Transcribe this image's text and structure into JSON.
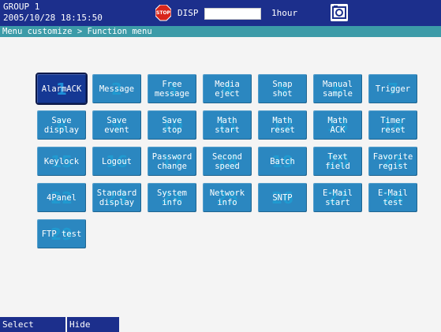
{
  "status": {
    "group": "GROUP 1",
    "datetime": "2005/10/28 18:15:50",
    "stop_icon_text": "STOP",
    "mode": "DISP",
    "time_span": "1hour"
  },
  "breadcrumb": "Menu customize > Function menu",
  "menu_items": [
    {
      "line1": "AlarmACK",
      "line2": "",
      "slot": "1"
    },
    {
      "line1": "Message",
      "line2": "",
      "slot": "2"
    },
    {
      "line1": "Free",
      "line2": "message",
      "slot": "3"
    },
    {
      "line1": "Media",
      "line2": "eject",
      "slot": "4"
    },
    {
      "line1": "Snap",
      "line2": "shot",
      "slot": "5"
    },
    {
      "line1": "Manual",
      "line2": "sample",
      "slot": "6"
    },
    {
      "line1": "Trigger",
      "line2": "",
      "slot": "7"
    },
    {
      "line1": "Save",
      "line2": "display",
      "slot": "8"
    },
    {
      "line1": "Save",
      "line2": "event",
      "slot": "9"
    },
    {
      "line1": "Save",
      "line2": "stop",
      "slot": "10"
    },
    {
      "line1": "Math",
      "line2": "start",
      "slot": "11"
    },
    {
      "line1": "Math",
      "line2": "reset",
      "slot": "12"
    },
    {
      "line1": "Math",
      "line2": "ACK",
      "slot": "13"
    },
    {
      "line1": "Timer",
      "line2": "reset",
      "slot": "14"
    },
    {
      "line1": "Keylock",
      "line2": "",
      "slot": "15"
    },
    {
      "line1": "Logout",
      "line2": "",
      "slot": "16"
    },
    {
      "line1": "Password",
      "line2": "change",
      "slot": "17"
    },
    {
      "line1": "Second",
      "line2": "speed",
      "slot": "18"
    },
    {
      "line1": "Batch",
      "line2": "",
      "slot": "19"
    },
    {
      "line1": "Text",
      "line2": "field",
      "slot": "20"
    },
    {
      "line1": "Favorite",
      "line2": "regist",
      "slot": "21"
    },
    {
      "line1": "4Panel",
      "line2": "",
      "slot": "22"
    },
    {
      "line1": "Standard",
      "line2": "display",
      "slot": "23"
    },
    {
      "line1": "System",
      "line2": "info",
      "slot": "24"
    },
    {
      "line1": "Network",
      "line2": "info",
      "slot": "25"
    },
    {
      "line1": "SNTP",
      "line2": "",
      "slot": "26"
    },
    {
      "line1": "E-Mail",
      "line2": "start",
      "slot": "27"
    },
    {
      "line1": "E-Mail",
      "line2": "test",
      "slot": "28"
    },
    {
      "line1": "FTP test",
      "line2": "",
      "slot": "29"
    }
  ],
  "softkeys": {
    "select": "Select",
    "hide": "Hide"
  },
  "colors": {
    "status_bar": "#1c2f8c",
    "breadcrumb_bar": "#3c9ba8",
    "button": "#2b87c0",
    "button_selected": "#153894",
    "stop_red": "#d8261c"
  }
}
